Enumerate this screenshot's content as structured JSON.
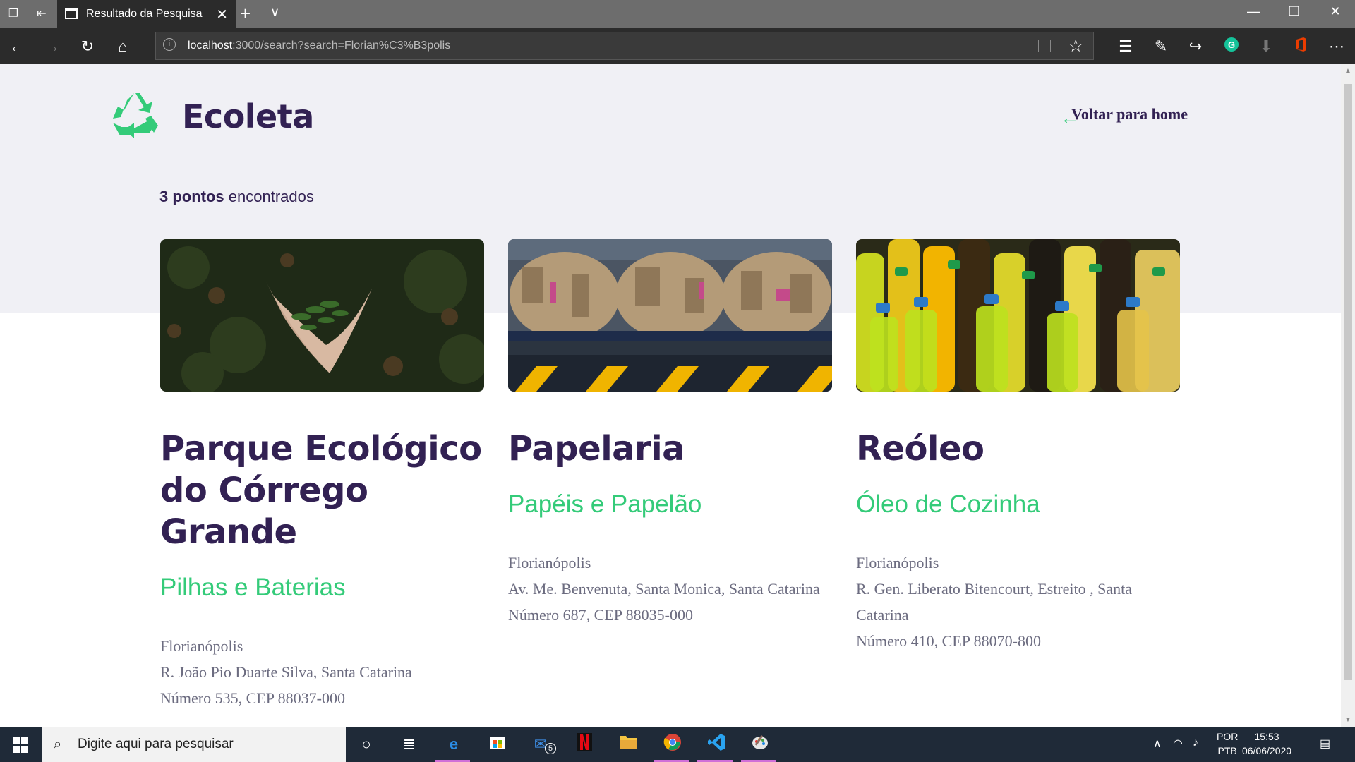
{
  "browser": {
    "tab_title": "Resultado da Pesquisa",
    "url_host": "localhost",
    "url_rest": ":3000/search?search=Florian%C3%B3polis"
  },
  "header": {
    "brand": "Ecoleta",
    "back_link": "Voltar para home"
  },
  "results": {
    "count_bold": "3 pontos",
    "count_rest": " encontrados"
  },
  "cards": [
    {
      "name": "Parque Ecológico do Córrego Grande",
      "items": "Pilhas e Baterias",
      "city": "Florianópolis",
      "street": "R. João Pio Duarte Silva, Santa Catarina",
      "number": "Número 535, CEP 88037-000"
    },
    {
      "name": "Papelaria",
      "items": "Papéis e Papelão",
      "city": "Florianópolis",
      "street": "Av. Me. Benvenuta, Santa Monica, Santa Catarina",
      "number": "Número 687, CEP 88035-000"
    },
    {
      "name": "Reóleo",
      "items": "Óleo de Cozinha",
      "city": "Florianópolis",
      "street": "R. Gen. Liberato Bitencourt, Estreito , Santa Catarina",
      "number": "Número 410, CEP 88070-800"
    }
  ],
  "taskbar": {
    "search_placeholder": "Digite aqui para pesquisar",
    "mail_badge": "5",
    "lang_top": "POR",
    "lang_bottom": "PTB",
    "time": "15:53",
    "date": "06/06/2020"
  },
  "colors": {
    "primary": "#322153",
    "accent": "#34cb79",
    "text": "#6c6c80",
    "background": "#f0f0f5"
  }
}
